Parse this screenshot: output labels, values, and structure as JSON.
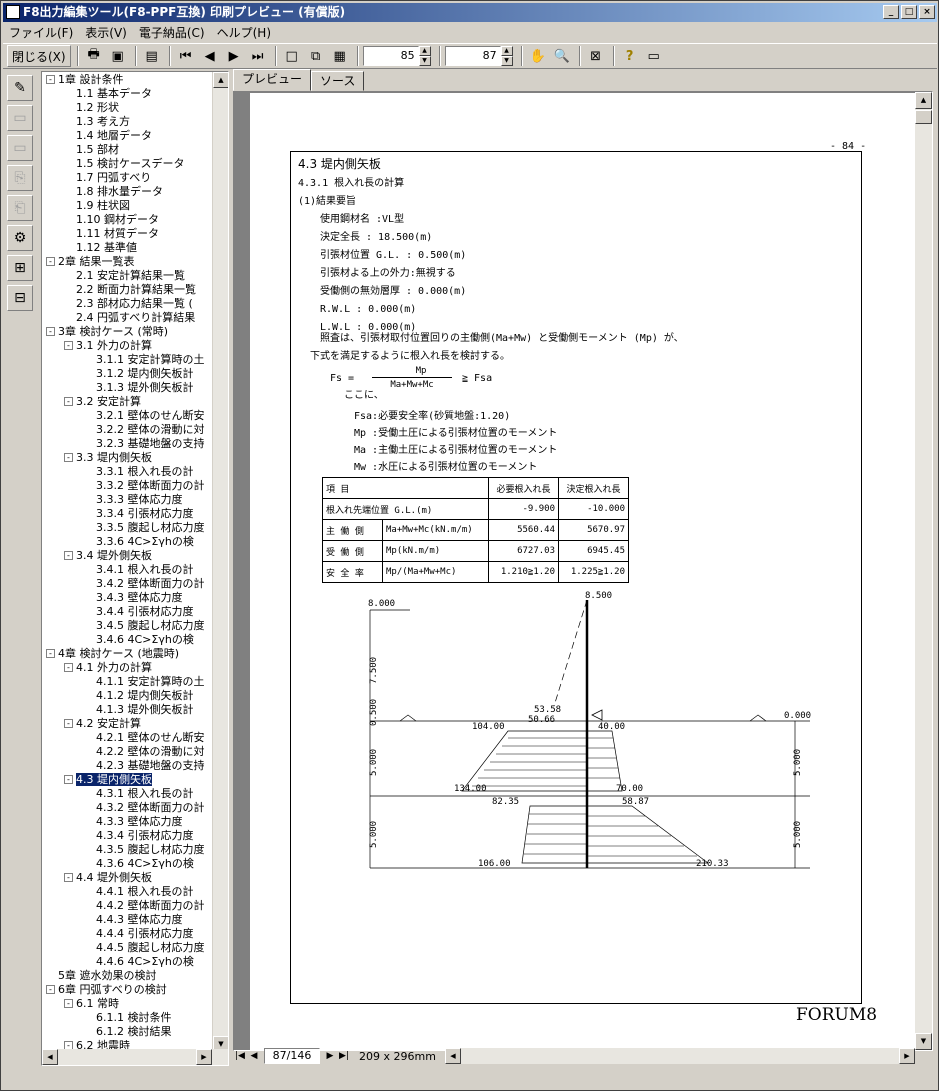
{
  "window": {
    "title": "F8出力編集ツール(F8-PPF互換) 印刷プレビュー (有償版)",
    "min": "_",
    "max": "□",
    "close": "×"
  },
  "menu": [
    "ファイル(F)",
    "表示(V)",
    "電子納品(C)",
    "ヘルプ(H)"
  ],
  "toolbar": {
    "close_label": "閉じる(X)",
    "zoom_a": "85",
    "zoom_b": "87"
  },
  "tabs": [
    "プレビュー",
    "ソース"
  ],
  "tree": [
    {
      "t": "1章 設計条件",
      "lv": 0,
      "pm": "-"
    },
    {
      "t": "1.1 基本データ",
      "lv": 1
    },
    {
      "t": "1.2 形状",
      "lv": 1
    },
    {
      "t": "1.3 考え方",
      "lv": 1
    },
    {
      "t": "1.4 地層データ",
      "lv": 1
    },
    {
      "t": "1.5 部材",
      "lv": 1
    },
    {
      "t": "1.5 検討ケースデータ",
      "lv": 1
    },
    {
      "t": "1.7 円弧すべり",
      "lv": 1
    },
    {
      "t": "1.8 排水量データ",
      "lv": 1
    },
    {
      "t": "1.9 柱状図",
      "lv": 1
    },
    {
      "t": "1.10 鋼材データ",
      "lv": 1
    },
    {
      "t": "1.11 材質データ",
      "lv": 1
    },
    {
      "t": "1.12 基準値",
      "lv": 1
    },
    {
      "t": "2章 結果一覧表",
      "lv": 0,
      "pm": "-"
    },
    {
      "t": "2.1 安定計算結果一覧",
      "lv": 1
    },
    {
      "t": "2.2 断面力計算結果一覧",
      "lv": 1
    },
    {
      "t": "2.3 部材応力結果一覧 (",
      "lv": 1
    },
    {
      "t": "2.4 円弧すべり計算結果",
      "lv": 1
    },
    {
      "t": "3章 検討ケース (常時)",
      "lv": 0,
      "pm": "-"
    },
    {
      "t": "3.1 外力の計算",
      "lv": 1,
      "pm": "-"
    },
    {
      "t": "3.1.1 安定計算時の土",
      "lv": 2
    },
    {
      "t": "3.1.2 堤内側矢板計",
      "lv": 2
    },
    {
      "t": "3.1.3 堤外側矢板計",
      "lv": 2
    },
    {
      "t": "3.2 安定計算",
      "lv": 1,
      "pm": "-"
    },
    {
      "t": "3.2.1 壁体のせん断安",
      "lv": 2
    },
    {
      "t": "3.2.2 壁体の滑動に対",
      "lv": 2
    },
    {
      "t": "3.2.3 基礎地盤の支持",
      "lv": 2
    },
    {
      "t": "3.3 堤内側矢板",
      "lv": 1,
      "pm": "-"
    },
    {
      "t": "3.3.1 根入れ長の計",
      "lv": 2
    },
    {
      "t": "3.3.2 壁体断面力の計",
      "lv": 2
    },
    {
      "t": "3.3.3 壁体応力度",
      "lv": 2
    },
    {
      "t": "3.3.4 引張材応力度",
      "lv": 2
    },
    {
      "t": "3.3.5 腹起し材応力度",
      "lv": 2
    },
    {
      "t": "3.3.6 4C>Σγhの検",
      "lv": 2
    },
    {
      "t": "3.4 堤外側矢板",
      "lv": 1,
      "pm": "-"
    },
    {
      "t": "3.4.1 根入れ長の計",
      "lv": 2
    },
    {
      "t": "3.4.2 壁体断面力の計",
      "lv": 2
    },
    {
      "t": "3.4.3 壁体応力度",
      "lv": 2
    },
    {
      "t": "3.4.4 引張材応力度",
      "lv": 2
    },
    {
      "t": "3.4.5 腹起し材応力度",
      "lv": 2
    },
    {
      "t": "3.4.6 4C>Σγhの検",
      "lv": 2
    },
    {
      "t": "4章 検討ケース (地震時)",
      "lv": 0,
      "pm": "-"
    },
    {
      "t": "4.1 外力の計算",
      "lv": 1,
      "pm": "-"
    },
    {
      "t": "4.1.1 安定計算時の土",
      "lv": 2
    },
    {
      "t": "4.1.2 堤内側矢板計",
      "lv": 2
    },
    {
      "t": "4.1.3 堤外側矢板計",
      "lv": 2
    },
    {
      "t": "4.2 安定計算",
      "lv": 1,
      "pm": "-"
    },
    {
      "t": "4.2.1 壁体のせん断安",
      "lv": 2
    },
    {
      "t": "4.2.2 壁体の滑動に対",
      "lv": 2
    },
    {
      "t": "4.2.3 基礎地盤の支持",
      "lv": 2
    },
    {
      "t": "4.3 堤内側矢板",
      "lv": 1,
      "pm": "-",
      "sel": true
    },
    {
      "t": "4.3.1 根入れ長の計",
      "lv": 2
    },
    {
      "t": "4.3.2 壁体断面力の計",
      "lv": 2
    },
    {
      "t": "4.3.3 壁体応力度",
      "lv": 2
    },
    {
      "t": "4.3.4 引張材応力度",
      "lv": 2
    },
    {
      "t": "4.3.5 腹起し材応力度",
      "lv": 2
    },
    {
      "t": "4.3.6 4C>Σγhの検",
      "lv": 2
    },
    {
      "t": "4.4 堤外側矢板",
      "lv": 1,
      "pm": "-"
    },
    {
      "t": "4.4.1 根入れ長の計",
      "lv": 2
    },
    {
      "t": "4.4.2 壁体断面力の計",
      "lv": 2
    },
    {
      "t": "4.4.3 壁体応力度",
      "lv": 2
    },
    {
      "t": "4.4.4 引張材応力度",
      "lv": 2
    },
    {
      "t": "4.4.5 腹起し材応力度",
      "lv": 2
    },
    {
      "t": "4.4.6 4C>Σγhの検",
      "lv": 2
    },
    {
      "t": "5章 遮水効果の検討",
      "lv": 0
    },
    {
      "t": "6章 円弧すべりの検討",
      "lv": 0,
      "pm": "-"
    },
    {
      "t": "6.1 常時",
      "lv": 1,
      "pm": "-"
    },
    {
      "t": "6.1.1 検討条件",
      "lv": 2
    },
    {
      "t": "6.1.2 検討結果",
      "lv": 2
    },
    {
      "t": "6.2 地震時",
      "lv": 1,
      "pm": "-"
    }
  ],
  "doc": {
    "page_no": "- 84 -",
    "heading": "4.3 堤内側矢板",
    "sub": "4.3.1 根入れ長の計算",
    "sub2": "(1)結果要旨",
    "lines": [
      "使用鋼材名       :VL型",
      "決定全長       : 18.500(m)",
      "引張材位置 G.L.   :  0.500(m)",
      "引張材よる上の外力:無視する",
      "受働側の無効層厚   :  0.000(m)",
      "R.W.L          :  0.000(m)",
      "L.W.L          :  0.000(m)"
    ],
    "para1": "照査は、引張材取付位置回りの主働側(Ma+Mw) と受働側モーメント (Mp) が、",
    "para2": "下式を満足するように根入れ長を検討する。",
    "formula_lhs": "Fs =",
    "formula_num": "Mp",
    "formula_den": "Ma+Mw+Mc",
    "formula_rhs": "≧  Fsa",
    "where": "ここに、",
    "defs": [
      "Fsa:必要安全率(砂質地盤:1.20)",
      "Mp :受働土圧による引張材位置のモーメント",
      "Ma :主働土圧による引張材位置のモーメント",
      "Mw :水圧による引張材位置のモーメント"
    ],
    "table": {
      "header": [
        "項        目",
        "",
        "必要根入れ長",
        "決定根入れ長"
      ],
      "rows": [
        [
          "根入れ先端位置 G.L.(m)",
          "",
          "-9.900",
          "-10.000"
        ],
        [
          "主 働 側",
          "Ma+Mw+Mc(kN.m/m)",
          "5560.44",
          "5670.97"
        ],
        [
          "受 働 側",
          "Mp(kN.m/m)",
          "6727.03",
          "6945.45"
        ],
        [
          "安 全 率",
          "Mp/(Ma+Mw+Mc)",
          "1.210≧1.20",
          "1.225≧1.20"
        ]
      ]
    },
    "diagram": {
      "lbl_top_left": "8.000",
      "lbl_top": "8.500",
      "lbl_right": "0.000",
      "dim_7500": "7.500",
      "dim_0500": "0.500",
      "dim_5000a": "5.000",
      "dim_5000b": "5.000",
      "dim_r5000a": "5.000",
      "dim_r5000b": "5.000",
      "v5358": "53.58",
      "v5066": "50.66",
      "v10400": "104.00",
      "v4000": "40.00",
      "v13400": "134.00",
      "v7000": "70.00",
      "v8235": "82.35",
      "v5887": "58.87",
      "v10600": "106.00",
      "v21033": "210.33"
    },
    "brand": "FORUM8"
  },
  "status": {
    "page": "87/146",
    "size": "209 x 296mm"
  }
}
